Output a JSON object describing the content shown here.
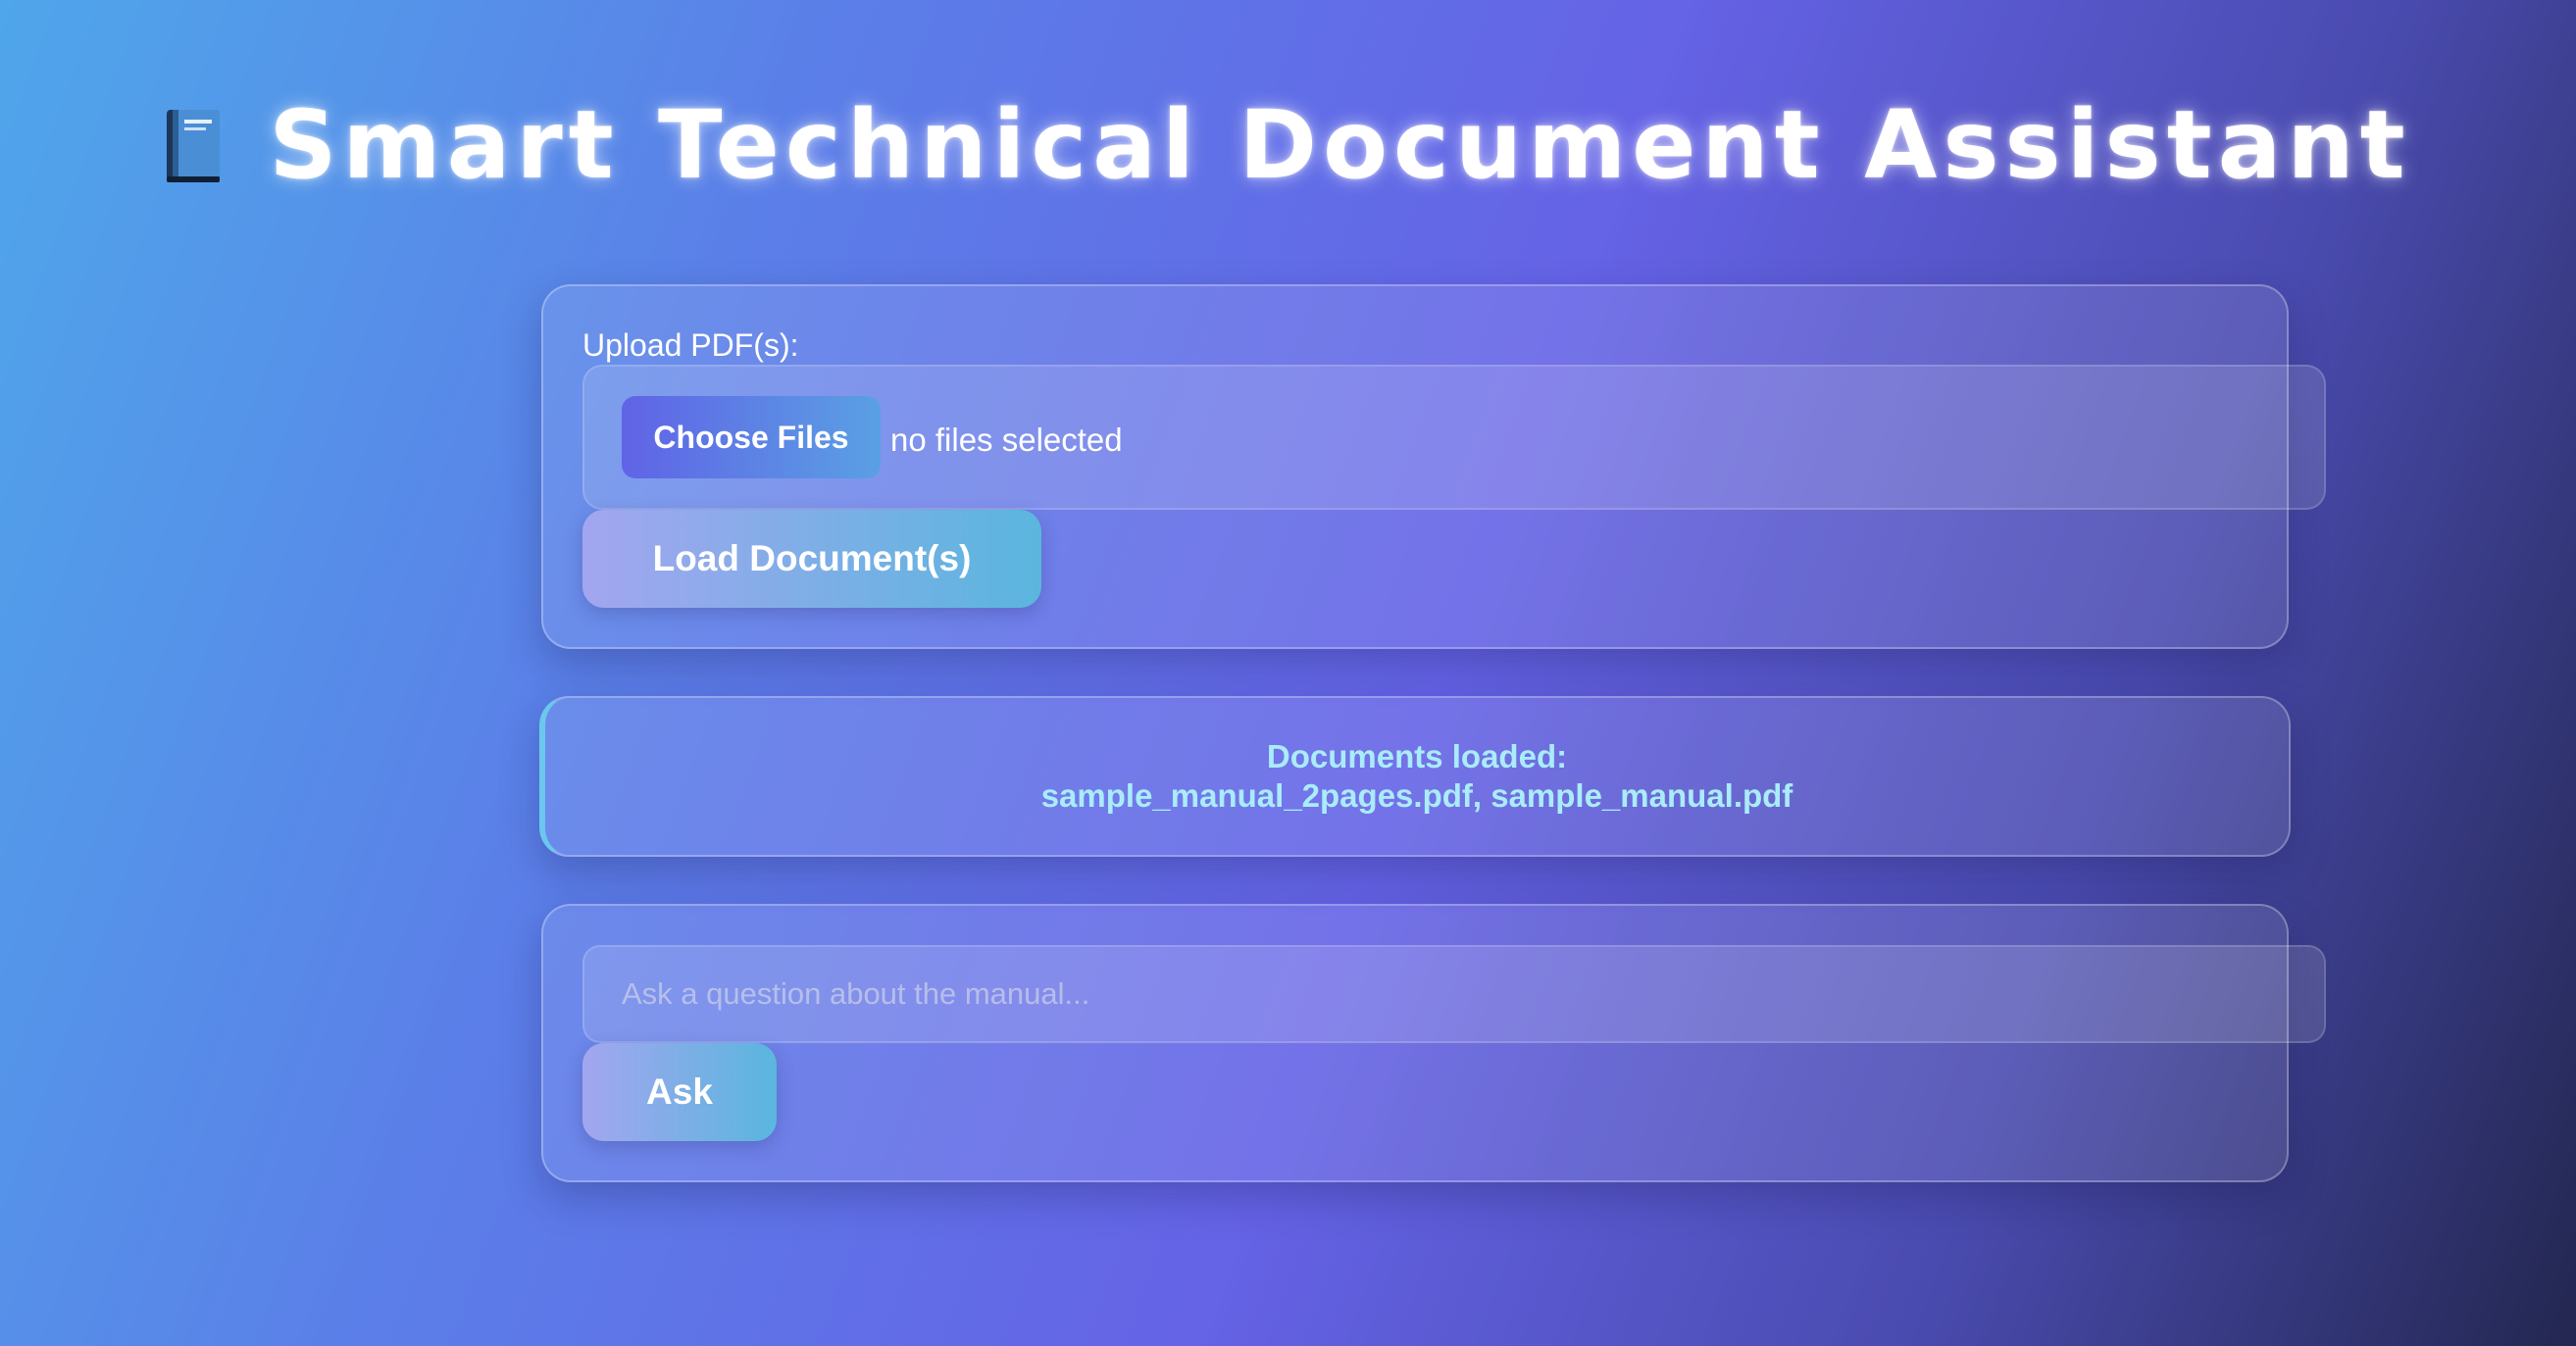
{
  "header": {
    "icon": "book-icon",
    "title": "Smart Technical Document Assistant"
  },
  "upload": {
    "label": "Upload PDF(s):",
    "choose_button": "Choose Files",
    "file_status": "no files selected",
    "load_button": "Load Document(s)"
  },
  "status": {
    "line1": "Documents loaded:",
    "line2": "sample_manual_2pages.pdf, sample_manual.pdf"
  },
  "ask": {
    "placeholder": "Ask a question about the manual...",
    "value": "",
    "button": "Ask"
  },
  "colors": {
    "accent": "#6063e6",
    "status_text": "#a9ecfa",
    "gradient_start": "#4fa6ea",
    "gradient_end": "#232750"
  }
}
